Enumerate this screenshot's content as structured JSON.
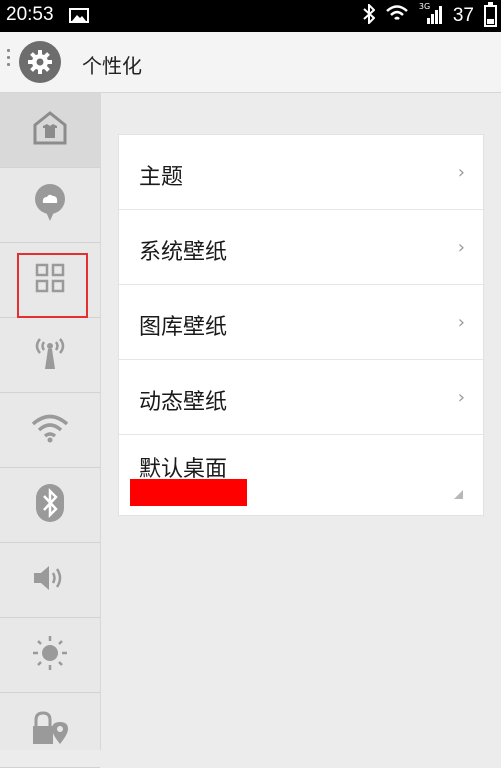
{
  "status_bar": {
    "time": "20:53",
    "network_label": "3G",
    "battery_percent": "37"
  },
  "header": {
    "title": "个性化",
    "icon": "gear-icon"
  },
  "sidebar": {
    "items": [
      {
        "icon": "home-icon",
        "active": true
      },
      {
        "icon": "cloud-chat-icon",
        "active": false
      },
      {
        "icon": "grid-icon",
        "active": false,
        "highlighted": true
      },
      {
        "icon": "hotspot-antenna-icon",
        "active": false
      },
      {
        "icon": "wifi-icon",
        "active": false
      },
      {
        "icon": "bluetooth-icon",
        "active": false
      },
      {
        "icon": "volume-icon",
        "active": false
      },
      {
        "icon": "brightness-icon",
        "active": false
      },
      {
        "icon": "lock-location-icon",
        "active": false
      }
    ]
  },
  "menu": {
    "items": [
      {
        "label": "主题"
      },
      {
        "label": "系统壁纸"
      },
      {
        "label": "图库壁纸"
      },
      {
        "label": "动态壁纸"
      },
      {
        "label": "默认桌面"
      }
    ]
  },
  "colors": {
    "highlight_border": "#e53030",
    "redaction": "#ff0000"
  }
}
